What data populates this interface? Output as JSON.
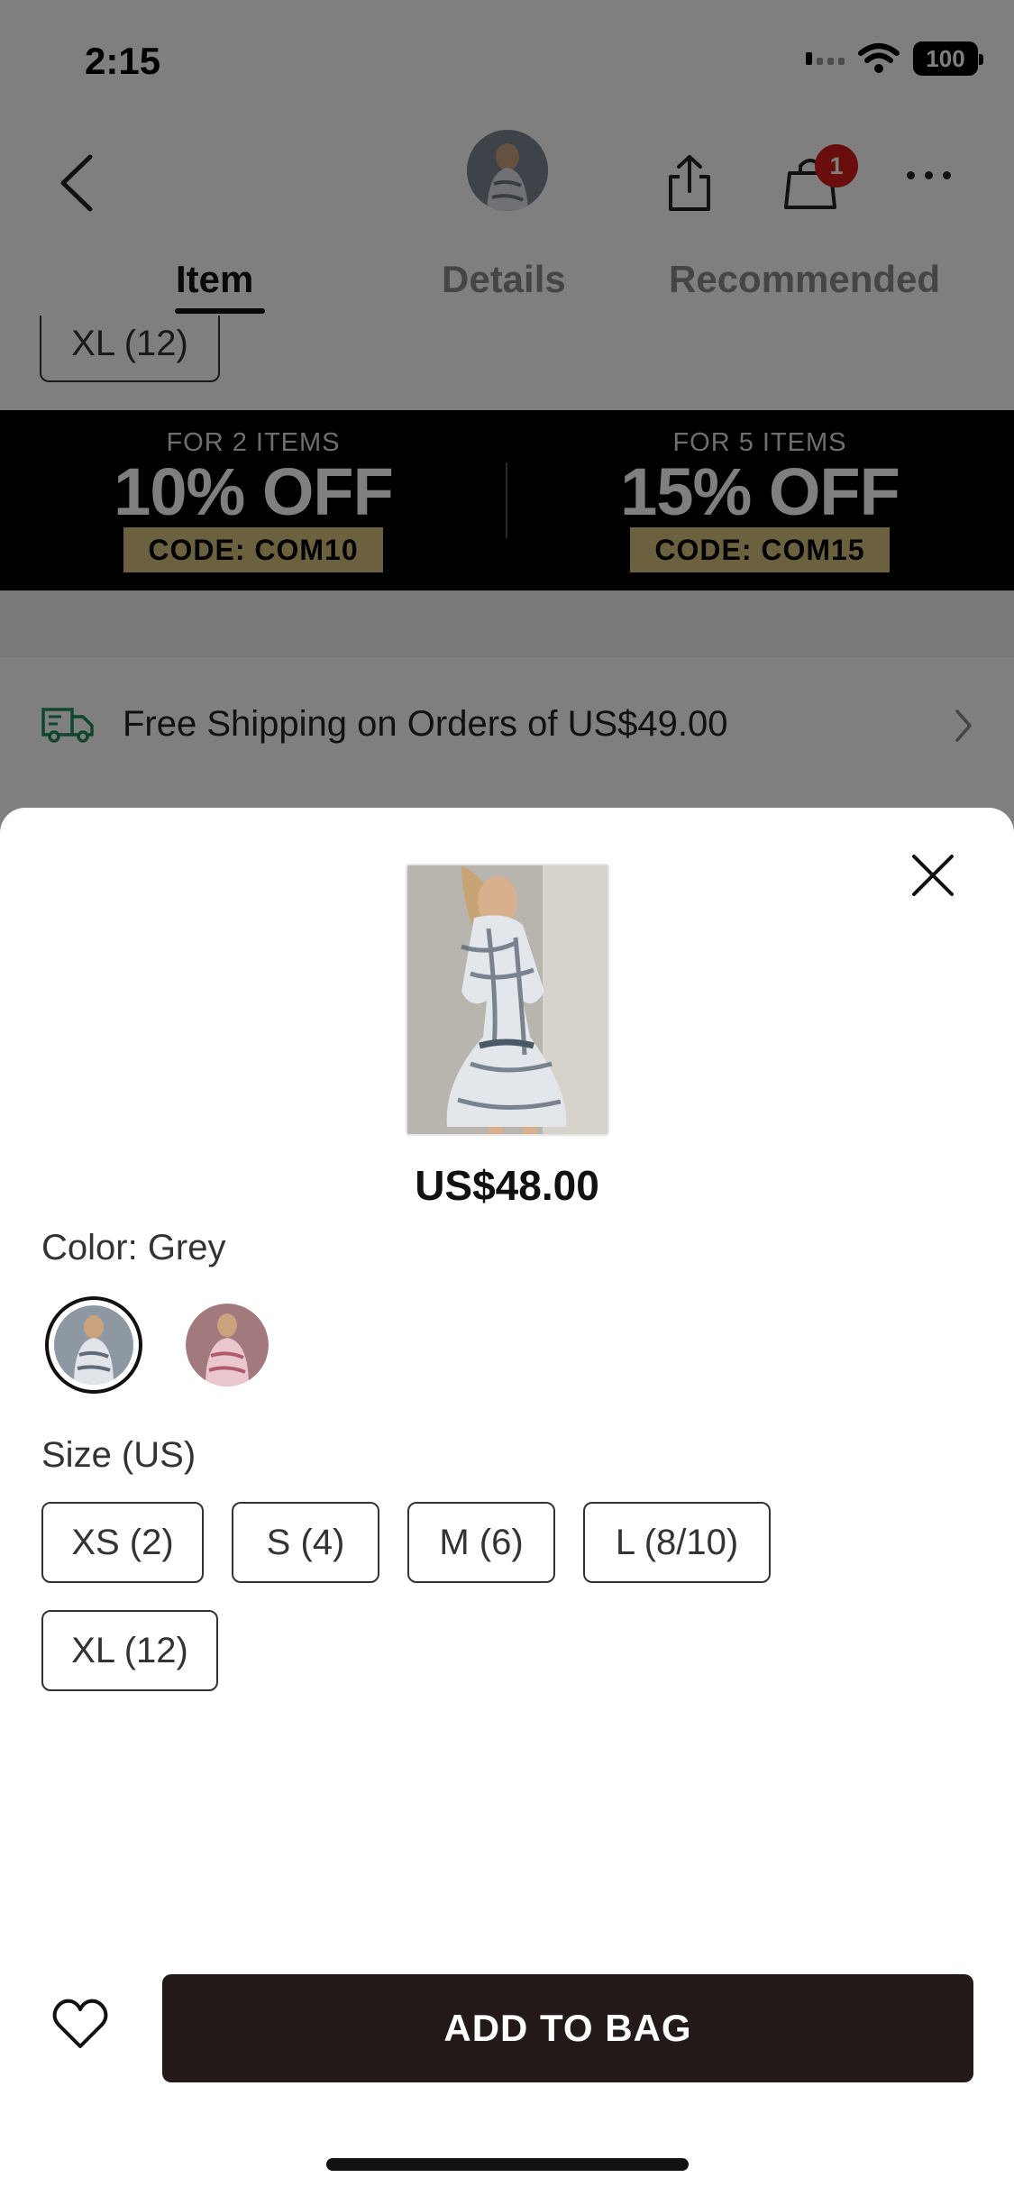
{
  "status_bar": {
    "time": "2:15",
    "battery": "100"
  },
  "nav": {
    "back_icon": "chevron-left-icon",
    "share_icon": "share-icon",
    "cart_icon": "shopping-bag-icon",
    "cart_count": "1",
    "more_icon": "more-horizontal-icon"
  },
  "tabs": [
    {
      "label": "Item",
      "active": true
    },
    {
      "label": "Details",
      "active": false
    },
    {
      "label": "Recommended",
      "active": false
    }
  ],
  "background": {
    "size_chip": "XL (12)",
    "promos": [
      {
        "top": "FOR 2 ITEMS",
        "big": "10% OFF",
        "code": "CODE: COM10"
      },
      {
        "top": "FOR 5 ITEMS",
        "big": "15% OFF",
        "code": "CODE: COM15"
      }
    ],
    "shipping_text": "Free Shipping on Orders of US$49.00"
  },
  "sheet": {
    "price": "US$48.00",
    "color_label": "Color: Grey",
    "colors": [
      {
        "name": "Grey",
        "selected": true
      },
      {
        "name": "Pink",
        "selected": false
      }
    ],
    "size_label": "Size (US)",
    "sizes": [
      "XS (2)",
      "S (4)",
      "M (6)",
      "L (8/10)",
      "XL (12)"
    ],
    "add_to_bag": "ADD TO BAG"
  },
  "colors": {
    "brand_dark": "#231919",
    "badge_red": "#d41a1a",
    "promo_gold": "#d6c27f",
    "shipping_green": "#1f8a5b"
  }
}
